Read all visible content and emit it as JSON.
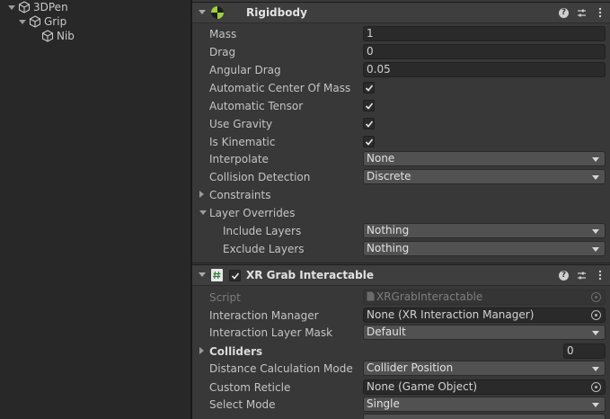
{
  "hierarchy": {
    "items": [
      {
        "label": "3DPen",
        "expanded": true,
        "icon": "cube-icon"
      },
      {
        "label": "Grip",
        "expanded": true,
        "icon": "cube-icon"
      },
      {
        "label": "Nib",
        "expanded": false,
        "icon": "cube-icon"
      }
    ]
  },
  "rigidbody": {
    "title": "Rigidbody",
    "icon": "rigidbody-icon",
    "mass_label": "Mass",
    "mass": "1",
    "drag_label": "Drag",
    "drag": "0",
    "angular_drag_label": "Angular Drag",
    "angular_drag": "0.05",
    "auto_center_label": "Automatic Center Of Mass",
    "auto_center": true,
    "auto_tensor_label": "Automatic Tensor",
    "auto_tensor": true,
    "use_gravity_label": "Use Gravity",
    "use_gravity": true,
    "is_kinematic_label": "Is Kinematic",
    "is_kinematic": true,
    "interpolate_label": "Interpolate",
    "interpolate": "None",
    "collision_label": "Collision Detection",
    "collision": "Discrete",
    "constraints_label": "Constraints",
    "layer_overrides_label": "Layer Overrides",
    "include_layers_label": "Include Layers",
    "include_layers": "Nothing",
    "exclude_layers_label": "Exclude Layers",
    "exclude_layers": "Nothing"
  },
  "xr_grab": {
    "title": "XR Grab Interactable",
    "icon": "script-hash-icon",
    "enabled": true,
    "script_label": "Script",
    "script": "XRGrabInteractable",
    "manager_label": "Interaction Manager",
    "manager": "None (XR Interaction Manager)",
    "layer_mask_label": "Interaction Layer Mask",
    "layer_mask": "Default",
    "colliders_label": "Colliders",
    "colliders_count": "0",
    "distance_mode_label": "Distance Calculation Mode",
    "distance_mode": "Collider Position",
    "reticle_label": "Custom Reticle",
    "reticle": "None (Game Object)",
    "select_mode_label": "Select Mode",
    "select_mode": "Single"
  },
  "colors": {
    "inspector_bg": "#383838",
    "hierarchy_bg": "#282828",
    "dropdown_bg": "#515151",
    "field_bg": "#2a2a2a"
  }
}
